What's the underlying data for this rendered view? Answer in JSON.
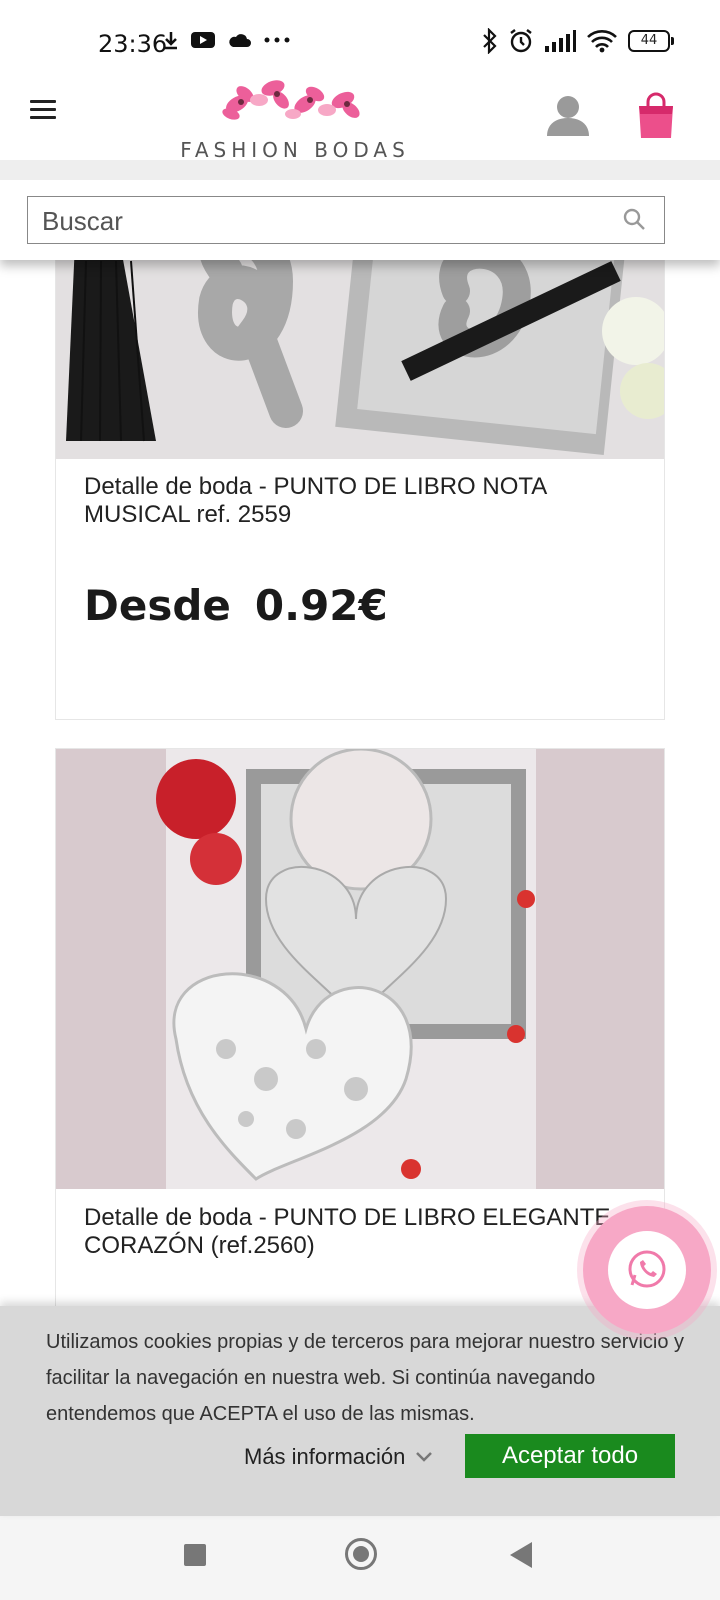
{
  "status_bar": {
    "time": "23:36",
    "left_icons": [
      "download-icon",
      "youtube-icon",
      "cloud-icon",
      "more-dots-icon"
    ],
    "right_icons": [
      "bluetooth-icon",
      "alarm-icon",
      "signal-icon",
      "wifi-icon"
    ],
    "battery": "44"
  },
  "header": {
    "brand": "FASHION BODAS",
    "menu_icon": "hamburger-menu-icon",
    "user_icon": "user-icon",
    "cart_icon": "shopping-bag-icon"
  },
  "search": {
    "placeholder": "Buscar",
    "icon": "search-icon"
  },
  "products": [
    {
      "title": "Detalle de boda - PUNTO DE LIBRO NOTA MUSICAL ref. 2559",
      "price_prefix": "Desde",
      "price": "0.92€"
    },
    {
      "title": "Detalle de boda - PUNTO DE LIBRO ELEGANTE CORAZÓN (ref.2560)"
    }
  ],
  "cookie_banner": {
    "text": "Utilizamos cookies propias y de terceros para mejorar nuestro servicio y facilitar la navegación en nuestra web. Si continúa navegando entendemos que ACEPTA el uso de las mismas.",
    "more_info_label": "Más información",
    "accept_label": "Aceptar todo"
  },
  "floating": {
    "icon": "whatsapp-icon"
  },
  "colors": {
    "accent_pink": "#f7a8c6",
    "accept_green": "#1a8a1e",
    "brand_text": "#555555"
  }
}
